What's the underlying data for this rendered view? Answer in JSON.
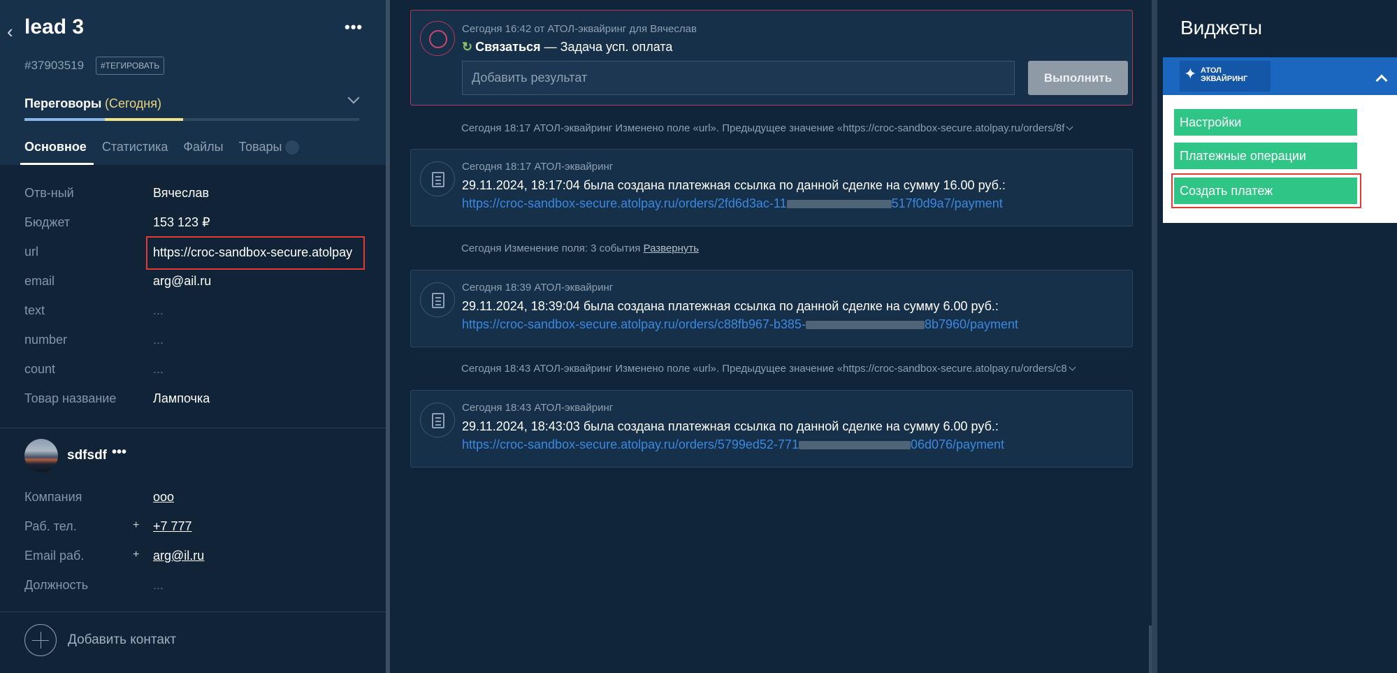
{
  "card": {
    "title": "lead 3",
    "more": "•••",
    "id": "#37903519",
    "tag_button": "#ТЕГИРОВАТЬ",
    "stage": "Переговоры",
    "stage_when": "(Сегодня)",
    "tabs": [
      "Основное",
      "Статистика",
      "Файлы",
      "Товары"
    ],
    "fields": [
      {
        "label": "Отв-ный",
        "value": "Вячеслав"
      },
      {
        "label": "Бюджет",
        "value": "153 123 ₽"
      },
      {
        "label": "url",
        "value": "https://croc-sandbox-secure.atolpay"
      },
      {
        "label": "email",
        "value": "arg@ail.ru"
      },
      {
        "label": "text",
        "value": "..."
      },
      {
        "label": "number",
        "value": "..."
      },
      {
        "label": "count",
        "value": "..."
      },
      {
        "label": "Товар название",
        "value": "Лампочка"
      }
    ],
    "contact": {
      "name": "sdfsdf",
      "more": "•••",
      "fields": [
        {
          "label": "Компания",
          "value": "ооо"
        },
        {
          "label": "Раб. тел.",
          "value": "+7 777"
        },
        {
          "label": "Email раб.",
          "value": "arg@il.ru"
        },
        {
          "label": "Должность",
          "value": "..."
        }
      ]
    },
    "add_contact": "Добавить контакт"
  },
  "feed": {
    "task": {
      "meta": "Сегодня 16:42 от АТОЛ-эквайринг для Вячеслав",
      "action": "Связаться",
      "dash": "—",
      "task_text": "Задача усп. оплата",
      "placeholder": "Добавить результат",
      "execute": "Выполнить"
    },
    "events": [
      {
        "type": "history",
        "text": "Сегодня 18:17 АТОЛ-эквайринг Изменено поле «url». Предыдущее значение «https://croc-sandbox-secure.atolpay.ru/orders/8f"
      },
      {
        "type": "note",
        "meta": "Сегодня 18:17 АТОЛ-эквайринг",
        "text": "29.11.2024, 18:17:04 была создана платежная ссылка по данной сделке на сумму 16.00 руб.:",
        "link": "https://croc-sandbox-secure.atolpay.ru/orders/2fd6d3ac-11",
        "link_tail": "517f0d9a7/payment"
      },
      {
        "type": "history",
        "text": "Сегодня Изменение поля: 3 события",
        "expand": "Развернуть"
      },
      {
        "type": "note",
        "meta": "Сегодня 18:39 АТОЛ-эквайринг",
        "text": "29.11.2024, 18:39:04 была создана платежная ссылка по данной сделке на сумму 6.00 руб.:",
        "link": "https://croc-sandbox-secure.atolpay.ru/orders/c88fb967-b385-",
        "link_tail": "8b7960/payment"
      },
      {
        "type": "history",
        "text": "Сегодня 18:43 АТОЛ-эквайринг Изменено поле «url». Предыдущее значение «https://croc-sandbox-secure.atolpay.ru/orders/c8"
      },
      {
        "type": "note",
        "meta": "Сегодня 18:43 АТОЛ-эквайринг",
        "text": "29.11.2024, 18:43:03 была создана платежная ссылка по данной сделке на сумму 6.00 руб.:",
        "link": "https://croc-sandbox-secure.atolpay.ru/orders/5799ed52-771",
        "link_tail": "06d076/payment"
      }
    ]
  },
  "widgets": {
    "title": "Виджеты",
    "logo_line1": "АТОЛ",
    "logo_line2": "ЭКВАЙРИНГ",
    "buttons": [
      "Настройки",
      "Платежные операции",
      "Создать платеж"
    ]
  },
  "colors": {
    "panel": "#17314a",
    "background": "#102337",
    "link": "#3b88e2",
    "accent_green": "#2fc586",
    "highlight_red": "#e53935",
    "widget_blue": "#1b66bf"
  }
}
